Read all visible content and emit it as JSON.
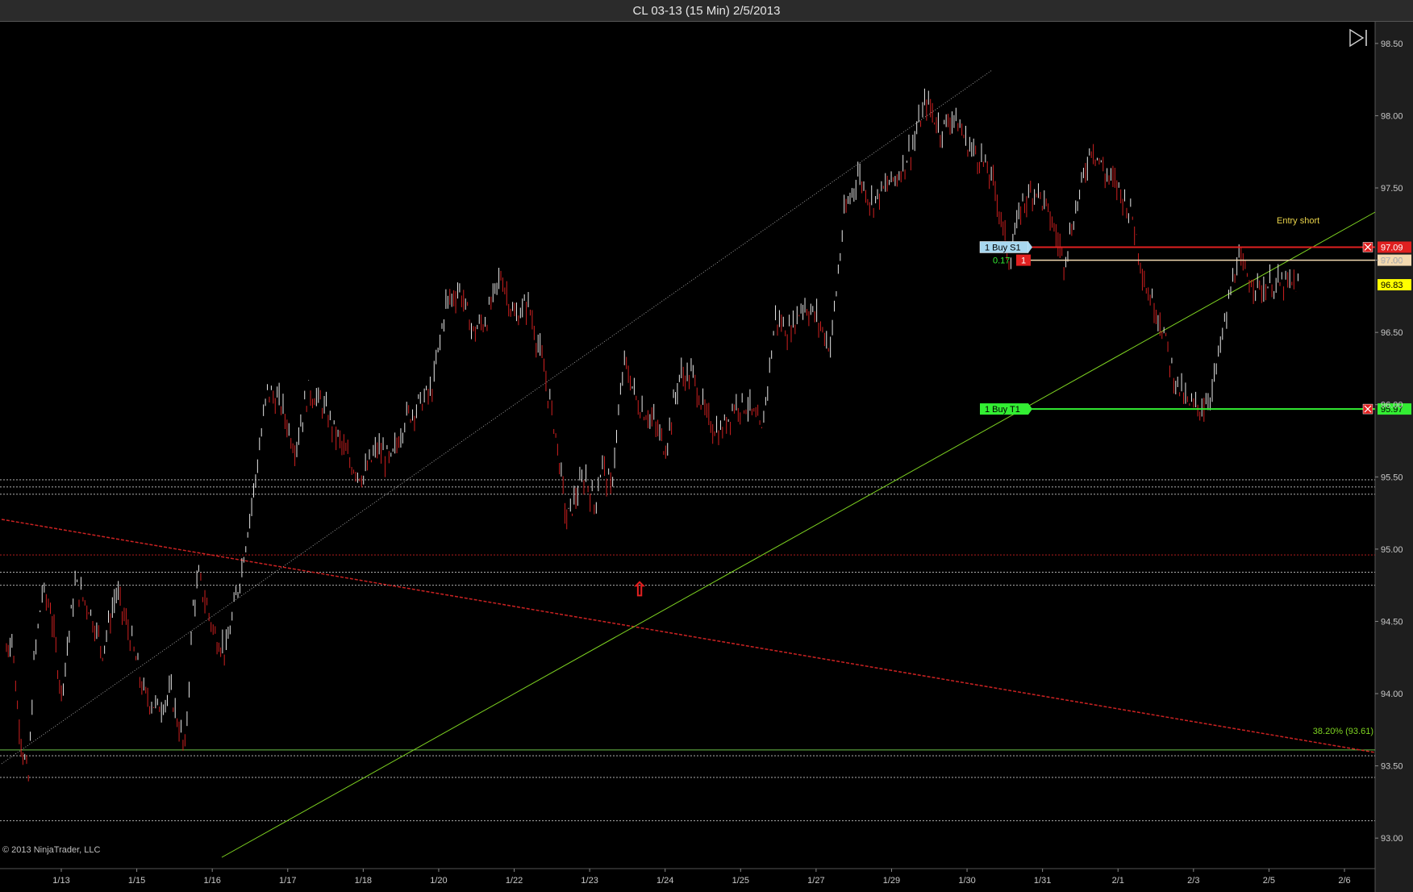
{
  "window": {
    "title": "CL 03-13 (15 Min)  2/5/2013"
  },
  "copyright": "© 2013 NinjaTrader, LLC",
  "colors": {
    "background": "#000000",
    "bull_bar": "#e8e8e8",
    "bear_bar": "#d02020",
    "green_trend": "#7ed321",
    "red_trend": "#cc2222",
    "axis_bg": "#1e1e1e"
  },
  "chart_data": {
    "type": "line",
    "instrument": "CL 03-13",
    "interval": "15 Min",
    "date": "2/5/2013",
    "ylim": [
      92.8,
      98.65
    ],
    "y_ticks": [
      93.0,
      93.5,
      94.0,
      94.5,
      95.0,
      95.5,
      96.0,
      96.5,
      97.0,
      97.5,
      98.0,
      98.5
    ],
    "y_tick_labels": [
      "93.00",
      "93.50",
      "94.00",
      "94.50",
      "95.00",
      "95.50",
      "96.00",
      "96.50",
      "97.00",
      "97.50",
      "98.00",
      "98.50"
    ],
    "x_labels": [
      "1/13",
      "1/15",
      "1/16",
      "1/17",
      "1/18",
      "1/20",
      "1/22",
      "1/23",
      "1/24",
      "1/25",
      "1/27",
      "1/29",
      "1/30",
      "1/31",
      "2/1",
      "2/3",
      "2/5",
      "2/6"
    ],
    "price_series": {
      "name": "",
      "x": [
        0,
        2,
        4,
        6,
        8,
        10,
        13,
        16,
        20,
        25,
        30,
        35,
        40,
        45,
        50,
        55,
        60,
        65,
        68,
        70,
        73,
        76,
        80,
        85,
        90,
        95,
        100,
        105,
        110,
        115,
        120,
        125,
        130,
        135,
        140,
        145,
        150,
        155,
        160,
        165,
        170,
        175,
        180,
        185,
        190,
        195,
        200,
        204,
        208,
        211,
        214,
        217,
        220,
        225,
        230,
        235,
        240,
        245,
        250,
        255,
        260,
        265,
        270,
        275,
        280,
        285,
        290,
        295,
        300,
        305,
        310,
        315,
        320,
        325,
        330,
        335,
        340,
        345,
        350,
        355,
        360,
        365,
        370,
        375,
        380,
        385,
        390,
        395,
        400,
        405,
        410,
        415,
        420,
        425,
        430,
        433,
        436,
        439,
        442,
        445,
        448,
        451,
        454,
        457,
        460,
        463,
        465,
        468,
        471
      ],
      "y": [
        94.3,
        94.4,
        93.9,
        93.6,
        93.4,
        94.2,
        94.7,
        94.6,
        94.0,
        94.75,
        94.6,
        94.3,
        94.7,
        94.4,
        94.0,
        93.9,
        94.0,
        93.6,
        94.6,
        94.8,
        94.6,
        94.4,
        94.3,
        94.8,
        95.4,
        96.1,
        96.0,
        95.7,
        96.1,
        96.0,
        95.8,
        95.6,
        95.5,
        95.7,
        95.6,
        95.9,
        96.0,
        96.1,
        96.7,
        96.8,
        96.5,
        96.6,
        96.9,
        96.6,
        96.7,
        96.3,
        95.8,
        95.2,
        95.4,
        95.5,
        95.3,
        95.6,
        95.4,
        96.3,
        96.0,
        95.9,
        95.7,
        96.2,
        96.2,
        95.9,
        95.8,
        96.0,
        96.0,
        95.8,
        96.6,
        96.5,
        96.7,
        96.6,
        96.4,
        97.3,
        97.6,
        97.4,
        97.5,
        97.6,
        97.8,
        98.1,
        97.9,
        98.0,
        97.8,
        97.7,
        97.5,
        97.0,
        97.4,
        97.5,
        97.3,
        97.0,
        97.4,
        97.8,
        97.6,
        97.5,
        97.3,
        96.8,
        96.6,
        96.2,
        96.0,
        95.98,
        96.0,
        96.1,
        96.4,
        96.7,
        97.0,
        96.9,
        96.85,
        96.8,
        96.83,
        96.83,
        96.83,
        96.83,
        96.83
      ]
    },
    "horizontal_levels": [
      {
        "price": 95.48,
        "style": "dotted",
        "color": "#c8c8c8"
      },
      {
        "price": 95.43,
        "style": "dotted",
        "color": "#c8c8c8"
      },
      {
        "price": 95.38,
        "style": "dotted",
        "color": "#c8c8c8"
      },
      {
        "price": 94.96,
        "style": "dotted",
        "color": "#cc2222"
      },
      {
        "price": 94.84,
        "style": "dotted",
        "color": "#c8c8c8"
      },
      {
        "price": 94.75,
        "style": "dotted",
        "color": "#c8c8c8"
      },
      {
        "price": 93.61,
        "style": "solid",
        "color": "#6cc24a"
      },
      {
        "price": 93.57,
        "style": "dotted",
        "color": "#c8c8c8"
      },
      {
        "price": 93.42,
        "style": "dotted",
        "color": "#c8c8c8"
      },
      {
        "price": 93.12,
        "style": "dotted",
        "color": "#c8c8c8"
      }
    ],
    "fib_label": "38.20% (93.61)",
    "orders": {
      "stop": {
        "label": "1   Buy S1",
        "price_label": "97.09",
        "price": 97.09
      },
      "entry": {
        "pnl": "0.17",
        "qty": "1",
        "price_label": "97.00",
        "price": 97.0
      },
      "last": {
        "price_label": "96.83",
        "price": 96.83
      },
      "target": {
        "label": "1   Buy T1",
        "price_label": "95.97",
        "price": 95.97
      }
    },
    "annotation": "Entry short"
  }
}
